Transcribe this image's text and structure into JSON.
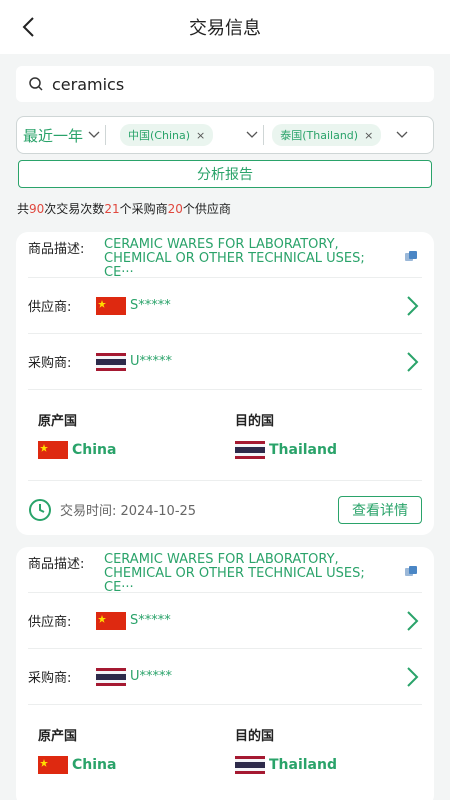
{
  "header": {
    "title": "交易信息"
  },
  "search": {
    "value": "ceramics"
  },
  "filters": {
    "period": "最近一年",
    "origin_chip": "中国(China)",
    "dest_chip": "泰国(Thailand)",
    "remove_symbol": "×"
  },
  "report_button": "分析报告",
  "summary": {
    "prefix": "共",
    "transactions": "90",
    "part1": "次交易次数",
    "buyers": "21",
    "part2": "个采购商",
    "suppliers": "20",
    "part3": "个供应商"
  },
  "cards": [
    {
      "desc_label": "商品描述:",
      "desc_text": "CERAMIC WARES FOR LABORATORY, CHEMICAL OR OTHER TECHNICAL USES; CE···",
      "supplier_label": "供应商:",
      "supplier_name": "S*****",
      "buyer_label": "采购商:",
      "buyer_name": "U*****",
      "origin_label": "原产国",
      "origin_country": "China",
      "dest_label": "目的国",
      "dest_country": "Thailand",
      "time_label": "交易时间: 2024-10-25",
      "detail_button": "查看详情"
    },
    {
      "desc_label": "商品描述:",
      "desc_text": "CERAMIC WARES FOR LABORATORY, CHEMICAL OR OTHER TECHNICAL USES; CE···",
      "supplier_label": "供应商:",
      "supplier_name": "S*****",
      "buyer_label": "采购商:",
      "buyer_name": "U*****",
      "origin_label": "原产国",
      "origin_country": "China",
      "dest_label": "目的国",
      "dest_country": "Thailand"
    }
  ],
  "colors": {
    "accent": "#2aa36a",
    "highlight": "#e0483e"
  }
}
